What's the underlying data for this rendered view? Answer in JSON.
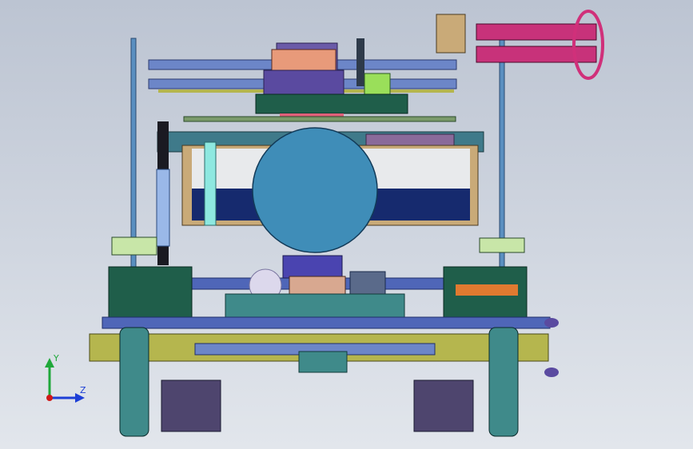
{
  "viewport": {
    "background_top": "#bcc4d2",
    "background_bottom": "#e2e6ec",
    "view_orientation": "front"
  },
  "triad": {
    "x_label": "",
    "y_label": "Y",
    "z_label": "Z",
    "y_color": "#1fa83a",
    "z_color": "#1d3fd6",
    "origin_color": "#d01818"
  },
  "model": {
    "description_icon": "robot-chassis-assembly",
    "colors": {
      "frame_blue": "#4f66b8",
      "frame_light": "#6c86c8",
      "drum_blue": "#3f8db8",
      "panel_white": "#e8eaec",
      "panel_navy": "#162a6e",
      "tan": "#c9aa78",
      "dark_green": "#1f5e4a",
      "olive": "#b5b64e",
      "purple": "#6a5aa8",
      "magenta": "#c8327a",
      "orange": "#e07a30",
      "dark_purple": "#4e456e",
      "teal": "#3f8a8a"
    }
  }
}
